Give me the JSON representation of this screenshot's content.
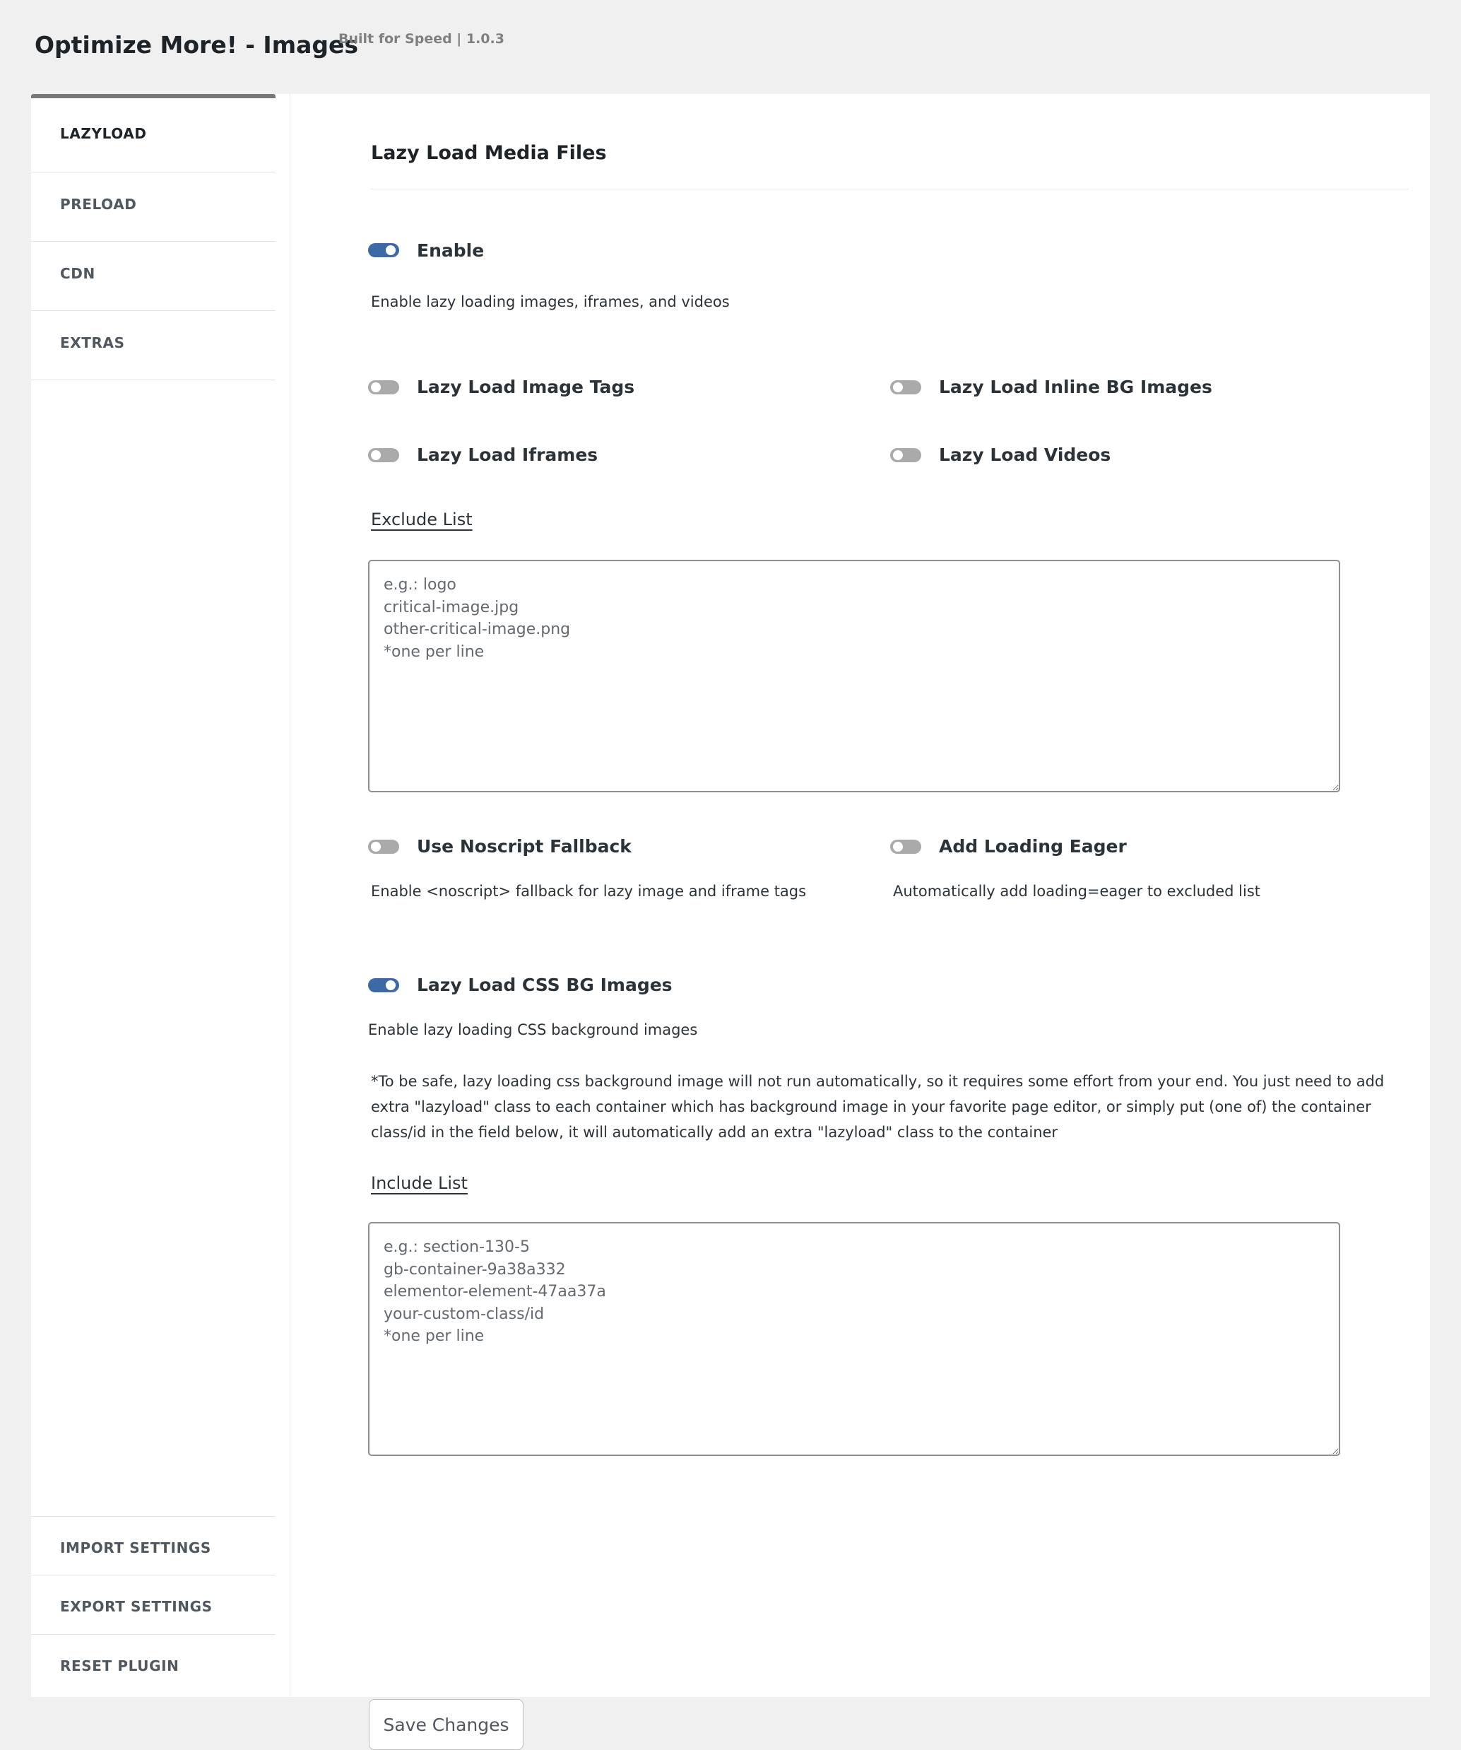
{
  "header": {
    "title": "Optimize More! - Images",
    "subtitle": "Built for Speed | 1.0.3"
  },
  "sidebar": {
    "items": [
      {
        "label": "LAZYLOAD",
        "active": true
      },
      {
        "label": "PRELOAD",
        "active": false
      },
      {
        "label": "CDN",
        "active": false
      },
      {
        "label": "EXTRAS",
        "active": false
      }
    ],
    "bottom_items": [
      {
        "label": "IMPORT SETTINGS"
      },
      {
        "label": "EXPORT SETTINGS"
      },
      {
        "label": "RESET PLUGIN"
      }
    ]
  },
  "main": {
    "section_title": "Lazy Load Media Files",
    "enable": {
      "label": "Enable",
      "on": true,
      "description": "Enable lazy loading images, iframes, and videos"
    },
    "options": [
      {
        "label": "Lazy Load Image Tags",
        "on": false
      },
      {
        "label": "Lazy Load Inline BG Images",
        "on": false
      },
      {
        "label": "Lazy Load Iframes",
        "on": false
      },
      {
        "label": "Lazy Load Videos",
        "on": false
      }
    ],
    "exclude_list": {
      "label": "Exclude List",
      "value": "",
      "placeholder": "e.g.: logo\ncritical-image.jpg\nother-critical-image.png\n*one per line"
    },
    "noscript": {
      "label": "Use Noscript Fallback",
      "on": false,
      "description": "Enable <noscript> fallback for lazy image and iframe tags"
    },
    "loading_eager": {
      "label": "Add Loading Eager",
      "on": false,
      "description": "Automatically add loading=eager to excluded list"
    },
    "css_bg": {
      "label": "Lazy Load CSS BG Images",
      "on": true,
      "description": "Enable lazy loading CSS background images",
      "note": "*To be safe, lazy loading css background image will not run automatically, so it requires some effort from your end. You just need to add extra \"lazyload\" class to each container which has background image in your favorite page editor, or simply put (one of) the container class/id in the field below, it will automatically add an extra \"lazyload\" class to the container"
    },
    "include_list": {
      "label": "Include List",
      "value": "",
      "placeholder": "e.g.: section-130-5\ngb-container-9a38a332\nelementor-element-47aa37a\nyour-custom-class/id\n*one per line"
    },
    "save_label": "Save Changes"
  },
  "colors": {
    "background": "#f0f0f1",
    "toggle_on": "#3c6aa8",
    "toggle_off": "#aaaaaa"
  }
}
